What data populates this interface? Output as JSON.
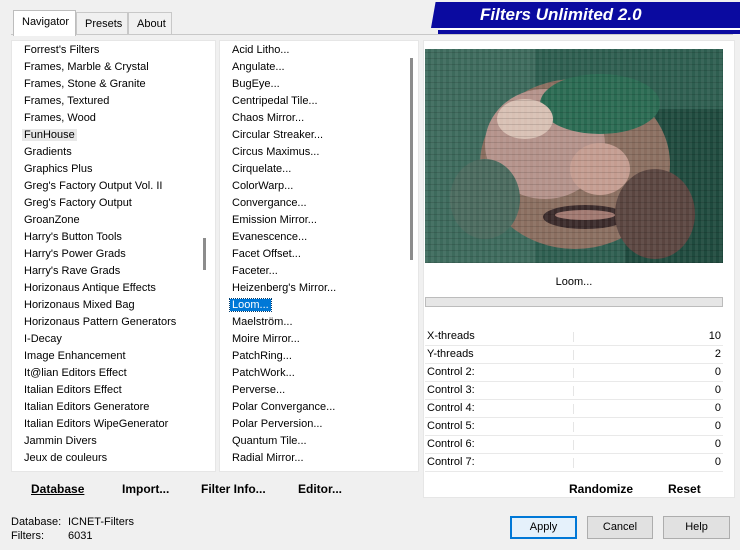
{
  "tabs": [
    {
      "label": "Navigator",
      "active": true
    },
    {
      "label": "Presets",
      "active": false
    },
    {
      "label": "About",
      "active": false
    }
  ],
  "banner": {
    "title": "Filters Unlimited 2.0",
    "color": "#0a0aa0"
  },
  "categories": {
    "selected": "FunHouse",
    "items": [
      "Forrest's Filters",
      "Frames, Marble & Crystal",
      "Frames, Stone & Granite",
      "Frames, Textured",
      "Frames, Wood",
      "FunHouse",
      "Gradients",
      "Graphics Plus",
      "Greg's Factory Output Vol. II",
      "Greg's Factory Output",
      "GroanZone",
      "Harry's Button Tools",
      "Harry's Power Grads",
      "Harry's Rave Grads",
      "Horizonaus Antique Effects",
      "Horizonaus Mixed Bag",
      "Horizonaus Pattern Generators",
      "I-Decay",
      "Image Enhancement",
      "It@lian Editors Effect",
      "Italian Editors Effect",
      "Italian Editors Generatore",
      "Italian Editors WipeGenerator",
      "Jammin Divers",
      "Jeux de couleurs"
    ]
  },
  "filters": {
    "selected": "Loom...",
    "items": [
      "Acid Litho...",
      "Angulate...",
      "BugEye...",
      "Centripedal Tile...",
      "Chaos Mirror...",
      "Circular Streaker...",
      "Circus Maximus...",
      "Cirquelate...",
      "ColorWarp...",
      "Convergance...",
      "Emission Mirror...",
      "Evanescence...",
      "Facet Offset...",
      "Faceter...",
      "Heizenberg's Mirror...",
      "Loom...",
      "Maelström...",
      "Moire Mirror...",
      "PatchRing...",
      "PatchWork...",
      "Perverse...",
      "Polar Convergance...",
      "Polar Perversion...",
      "Quantum Tile...",
      "Radial Mirror..."
    ]
  },
  "preview": {
    "filter_name": "Loom...",
    "progress": 0
  },
  "params": [
    {
      "label": "X-threads",
      "value": "10"
    },
    {
      "label": "Y-threads",
      "value": "2"
    },
    {
      "label": "Control 2:",
      "value": "0"
    },
    {
      "label": "Control 3:",
      "value": "0"
    },
    {
      "label": "Control 4:",
      "value": "0"
    },
    {
      "label": "Control 5:",
      "value": "0"
    },
    {
      "label": "Control 6:",
      "value": "0"
    },
    {
      "label": "Control 7:",
      "value": "0"
    }
  ],
  "bottom_bar": {
    "database": "Database",
    "import": "Import...",
    "filter_info": "Filter Info...",
    "editor": "Editor...",
    "randomize": "Randomize",
    "reset": "Reset"
  },
  "status": {
    "database_label": "Database:",
    "database_value": "ICNET-Filters",
    "filters_label": "Filters:",
    "filters_value": "6031"
  },
  "buttons": {
    "apply": "Apply",
    "cancel": "Cancel",
    "help": "Help"
  }
}
